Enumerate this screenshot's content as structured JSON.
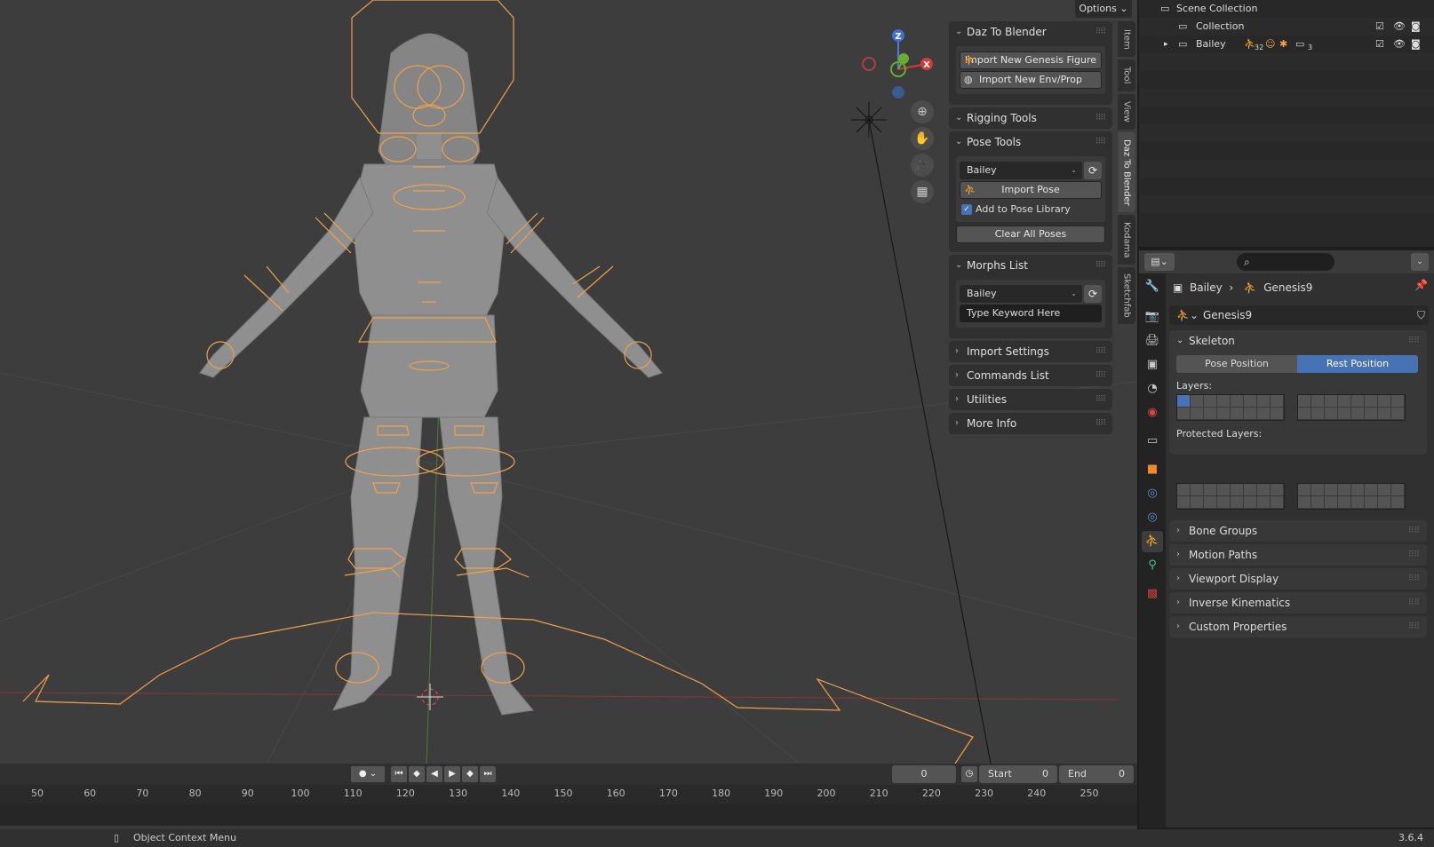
{
  "viewport": {
    "options_label": "Options",
    "gizmo": {
      "z": "Z",
      "x": "X"
    },
    "nav_icons": [
      "zoom-icon",
      "pan-hand-icon",
      "camera-icon",
      "grid-ortho-icon"
    ]
  },
  "npanel": {
    "daz_to_blender": {
      "title": "Daz To Blender",
      "import_genesis": "Import New Genesis Figure",
      "import_env": "Import New Env/Prop"
    },
    "rigging_tools": {
      "title": "Rigging Tools"
    },
    "pose_tools": {
      "title": "Pose Tools",
      "figure_select": "Bailey",
      "import_pose": "Import Pose",
      "add_to_library": "Add to Pose Library",
      "clear_all": "Clear All Poses"
    },
    "morphs_list": {
      "title": "Morphs List",
      "figure_select": "Bailey",
      "keyword_placeholder": "Type Keyword Here"
    },
    "import_settings": "Import Settings",
    "commands_list": "Commands List",
    "utilities": "Utilities",
    "more_info": "More Info"
  },
  "vertical_tabs": [
    "Item",
    "Tool",
    "View",
    "Daz To Blender",
    "Kodama",
    "Sketchfab"
  ],
  "timeline": {
    "frame_current": "0",
    "start_label": "Start",
    "start_value": "0",
    "end_label": "End",
    "end_value": "0",
    "ticks": [
      "50",
      "60",
      "70",
      "80",
      "90",
      "100",
      "110",
      "120",
      "130",
      "140",
      "150",
      "160",
      "170",
      "180",
      "190",
      "200",
      "210",
      "220",
      "230",
      "240",
      "250"
    ]
  },
  "status": {
    "context_menu": "Object Context Menu",
    "version": "3.6.4"
  },
  "outliner": {
    "scene_collection": "Scene Collection",
    "collection": "Collection",
    "bailey": "Bailey",
    "count_a": "32",
    "count_b": "3"
  },
  "properties": {
    "breadcrumb_object": "Bailey",
    "breadcrumb_data": "Genesis9",
    "data_name": "Genesis9",
    "skeleton_title": "Skeleton",
    "pose_position": "Pose Position",
    "rest_position": "Rest Position",
    "layers_label": "Layers:",
    "protected_layers_label": "Protected Layers:",
    "subpanels": [
      "Bone Groups",
      "Motion Paths",
      "Viewport Display",
      "Inverse Kinematics",
      "Custom Properties"
    ]
  },
  "colors": {
    "accent": "#4772b3",
    "armature": "#f0a04a",
    "viewport_bg": "#3d3d3d"
  }
}
